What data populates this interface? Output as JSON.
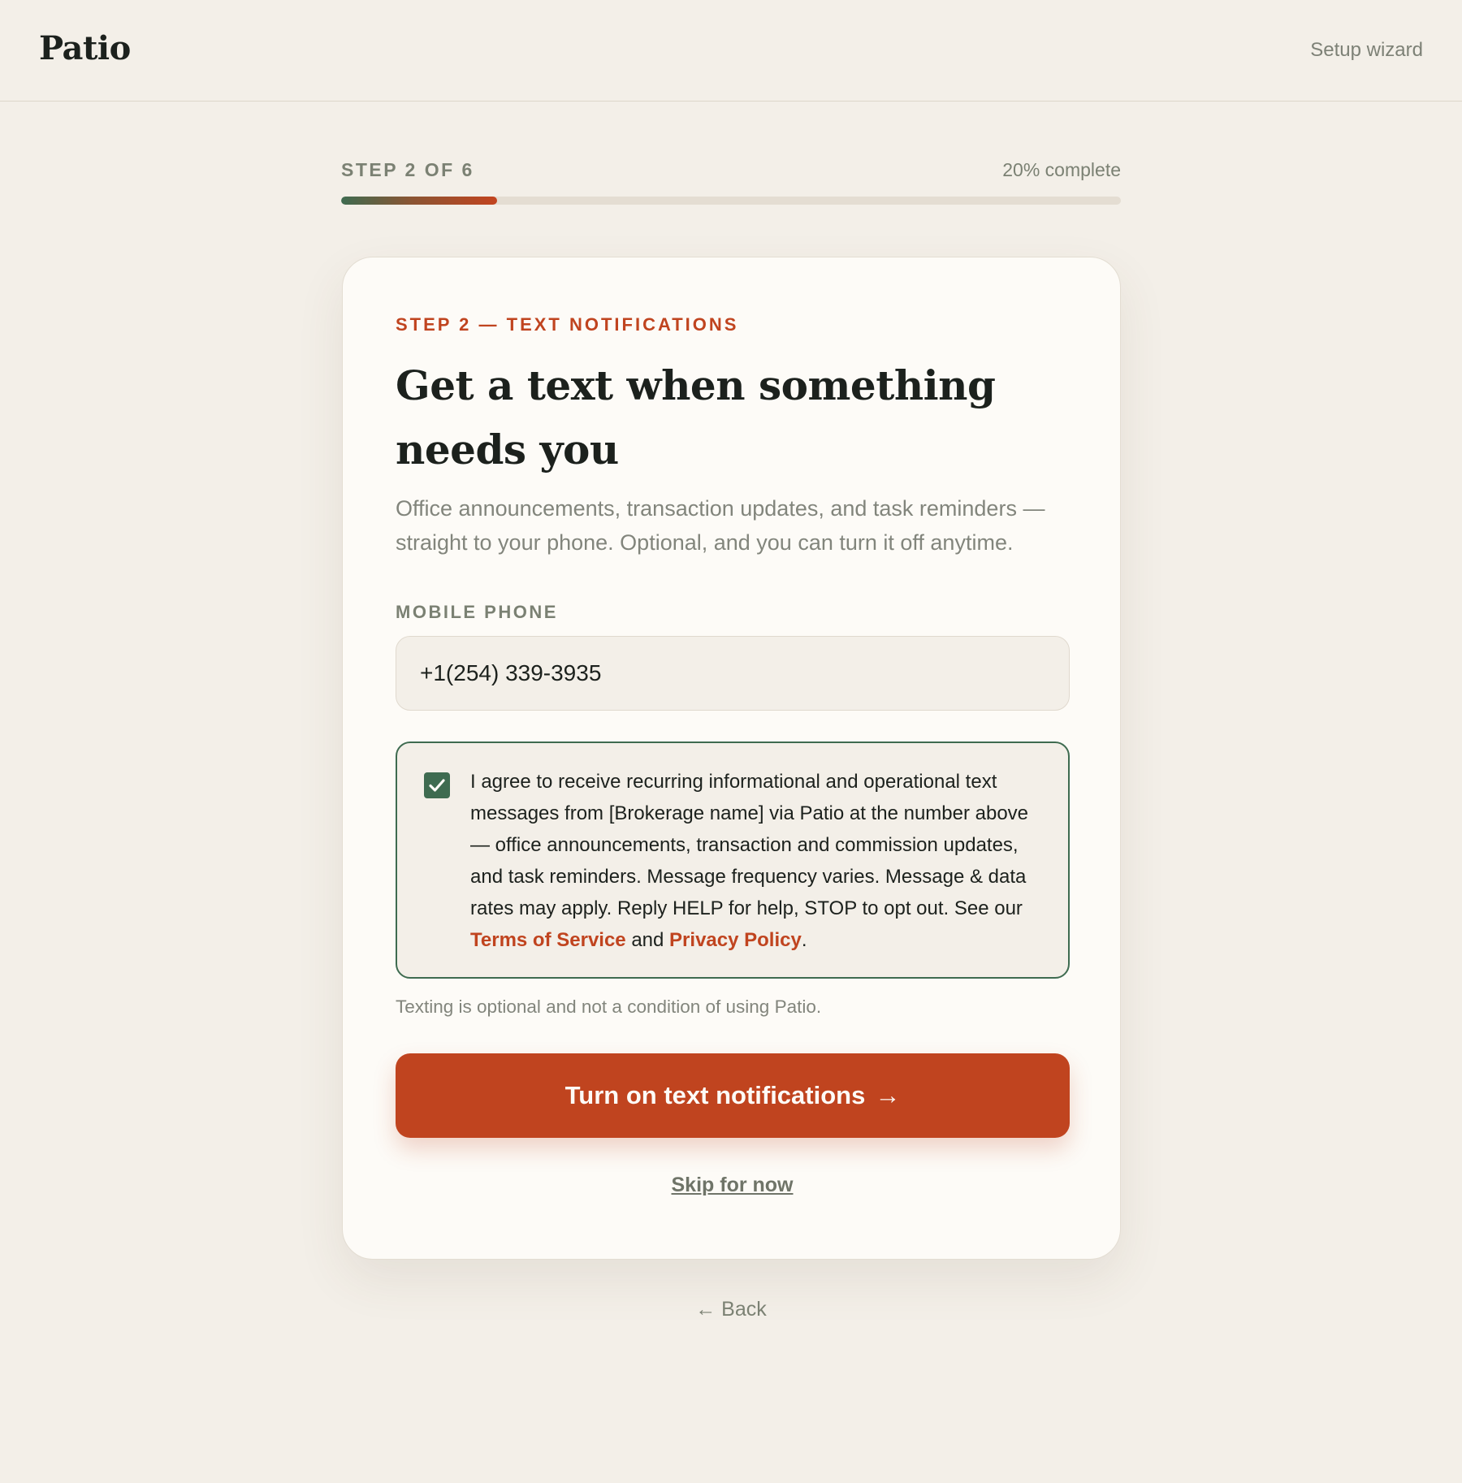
{
  "header": {
    "brand": "Patio",
    "nav_label": "Setup wizard"
  },
  "progress": {
    "step_label": "STEP 2 OF 6",
    "percent_label": "20% complete",
    "percent_value": 20
  },
  "card": {
    "eyebrow": "STEP 2 — TEXT NOTIFICATIONS",
    "headline": "Get a text when something needs you",
    "lede": "Office announcements, transaction updates, and task reminders — straight to your phone. Optional, and you can turn it off anytime.",
    "phone": {
      "label": "MOBILE PHONE",
      "value": "+1(254) 339-3935"
    },
    "consent": {
      "checked": true,
      "text_before": "I agree to receive recurring informational and operational text messages from [Brokerage name] via Patio at the number above — office announcements, transaction and commission updates, and task reminders. Message frequency varies. Message & data rates may apply. Reply HELP for help, STOP to opt out. See our ",
      "terms_link": "Terms of Service",
      "between": " and ",
      "privacy_link": "Privacy Policy",
      "text_after": "."
    },
    "note": "Texting is optional and not a condition of using Patio.",
    "primary_button": {
      "label": "Turn on text notifications",
      "arrow": "→"
    },
    "skip_label": "Skip for now"
  },
  "footer": {
    "back_label": "← Back"
  },
  "colors": {
    "background": "#f3efe8",
    "accent": "#c0441f",
    "green": "#3e6b50",
    "ink": "#1c211d",
    "muted": "#82857c"
  }
}
